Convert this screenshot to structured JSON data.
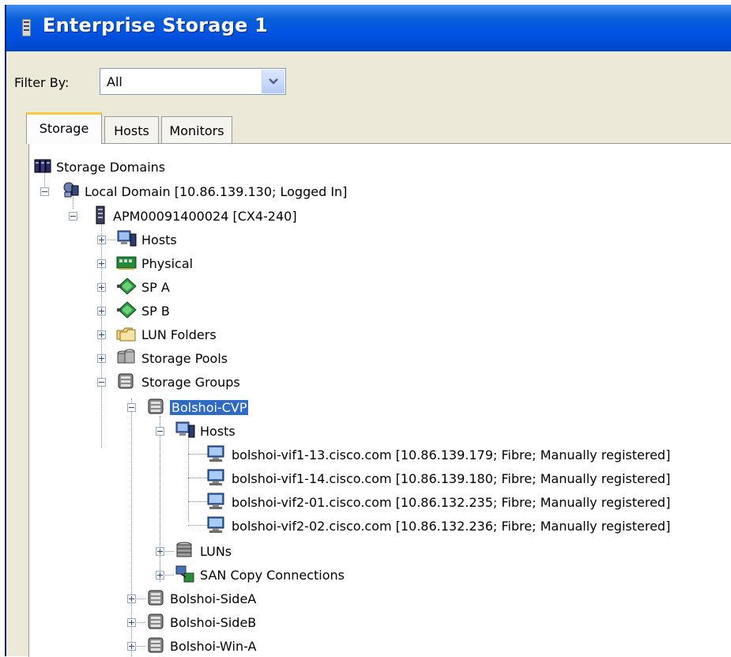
{
  "window": {
    "title": "Enterprise Storage 1"
  },
  "filter": {
    "label": "Filter By:",
    "value": "All"
  },
  "tabs": [
    {
      "label": "Storage",
      "active": true
    },
    {
      "label": "Hosts",
      "active": false
    },
    {
      "label": "Monitors",
      "active": false
    }
  ],
  "tree": {
    "root": "Storage Domains",
    "domain": "Local Domain [10.86.139.130; Logged In]",
    "array": "APM00091400024 [CX4-240]",
    "array_children": [
      "Hosts",
      "Physical",
      "SP A",
      "SP B",
      "LUN Folders",
      "Storage Pools",
      "Storage Groups"
    ],
    "group_selected": "Bolshoi-CVP",
    "group_hosts": "Hosts",
    "hosts": [
      "bolshoi-vif1-13.cisco.com [10.86.139.179; Fibre; Manually registered]",
      "bolshoi-vif1-14.cisco.com [10.86.139.180; Fibre; Manually registered]",
      "bolshoi-vif2-01.cisco.com [10.86.132.235; Fibre; Manually registered]",
      "bolshoi-vif2-02.cisco.com [10.86.132.236; Fibre; Manually registered]"
    ],
    "group_luns": "LUNs",
    "group_san_copy": "SAN Copy Connections",
    "other_groups": [
      "Bolshoi-SideA",
      "Bolshoi-SideB",
      "Bolshoi-Win-A"
    ]
  }
}
